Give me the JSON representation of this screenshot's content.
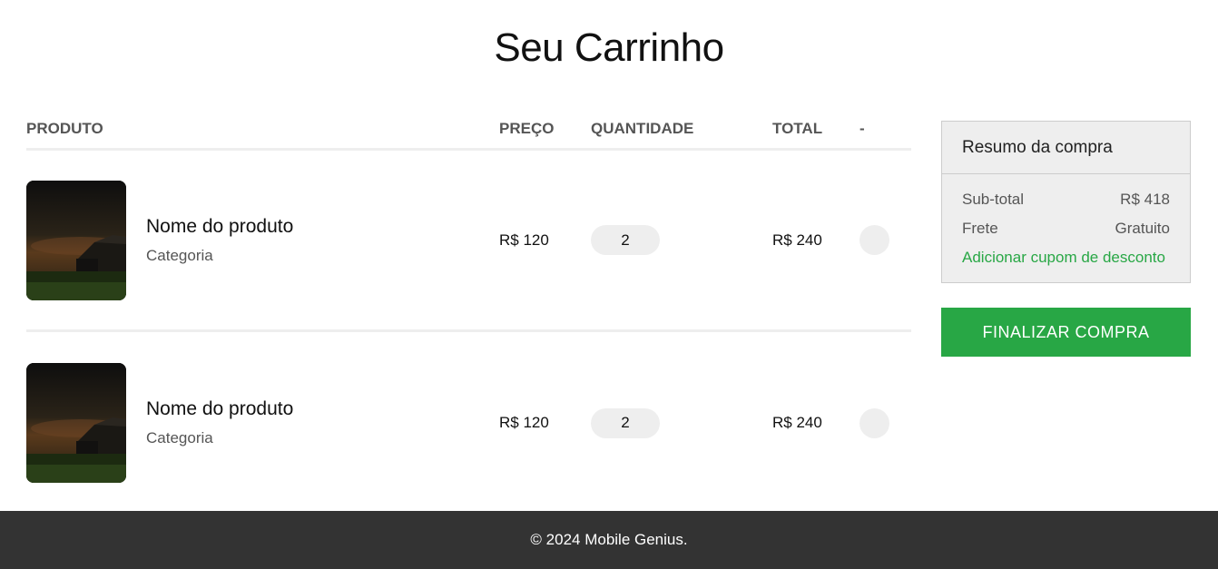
{
  "page_title": "Seu Carrinho",
  "cart": {
    "headers": {
      "product": "PRODUTO",
      "price": "PREÇO",
      "quantity": "QUANTIDADE",
      "total": "TOTAL",
      "remove": "-"
    },
    "items": [
      {
        "name": "Nome do produto",
        "category": "Categoria",
        "price": "R$ 120",
        "quantity": "2",
        "total": "R$ 240",
        "image_icon": "barn-night-photo"
      },
      {
        "name": "Nome do produto",
        "category": "Categoria",
        "price": "R$ 120",
        "quantity": "2",
        "total": "R$ 240",
        "image_icon": "barn-night-photo"
      }
    ]
  },
  "summary": {
    "title": "Resumo da compra",
    "subtotal_label": "Sub-total",
    "subtotal_value": "R$ 418",
    "shipping_label": "Frete",
    "shipping_value": "Gratuito",
    "coupon_link": "Adicionar cupom de desconto"
  },
  "checkout_button": "FINALIZAR COMPRA",
  "footer": {
    "text": "© 2024 Mobile Genius."
  },
  "colors": {
    "accent": "#28a745",
    "footer_bg": "#333333",
    "panel_bg": "#eeeeee"
  }
}
